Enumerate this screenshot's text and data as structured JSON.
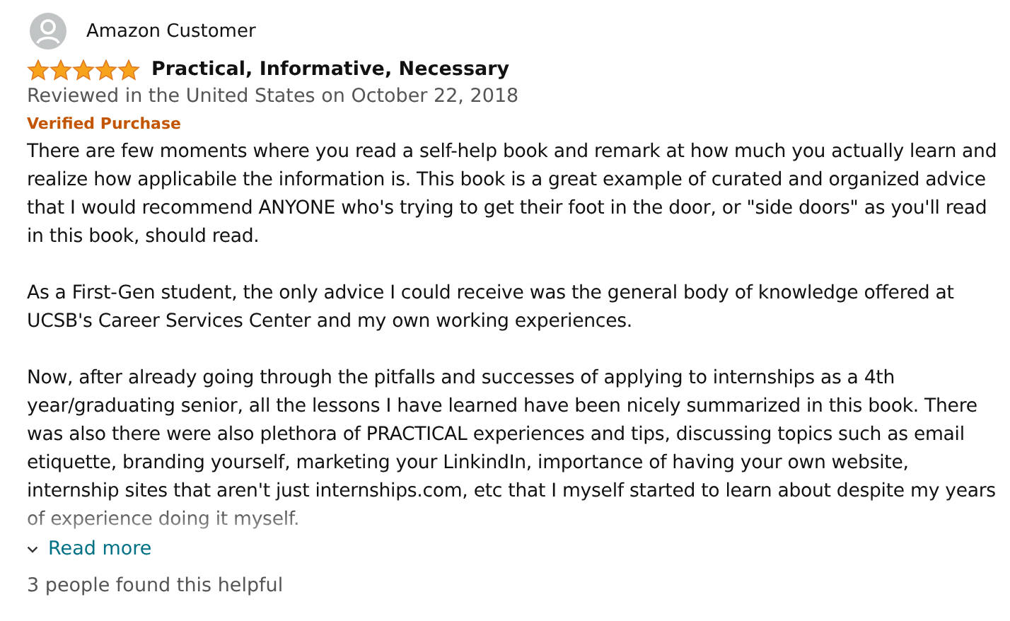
{
  "review": {
    "author": "Amazon Customer",
    "stars": 5,
    "title": "Practical, Informative, Necessary",
    "date": "Reviewed in the United States on October 22, 2018",
    "badge": "Verified Purchase",
    "paragraphs": [
      "There are few moments where you read a self-help book and remark at how much you actually learn and realize how applicabile the information is. This book is a great example of curated and organized advice that I would recommend ANYONE who's trying to get their foot in the door, or \"side doors\" as you'll read in this book, should read.",
      "As a First-Gen student, the only advice I could receive was the general body of knowledge offered at UCSB's Career Services Center and my own working experiences.",
      "Now, after already going through the pitfalls and successes of applying to internships as a 4th year/graduating senior, all the lessons I have learned have been nicely summarized in this book. There was also there were also plethora of PRACTICAL experiences and tips, discussing topics such as email etiquette, branding yourself, marketing your LinkindIn, importance of having your own website, internship sites that aren't just internships.com, etc that I myself started to learn about despite my years of experience doing it myself."
    ],
    "read_more": "Read more",
    "helpful": "3 people found this helpful"
  }
}
